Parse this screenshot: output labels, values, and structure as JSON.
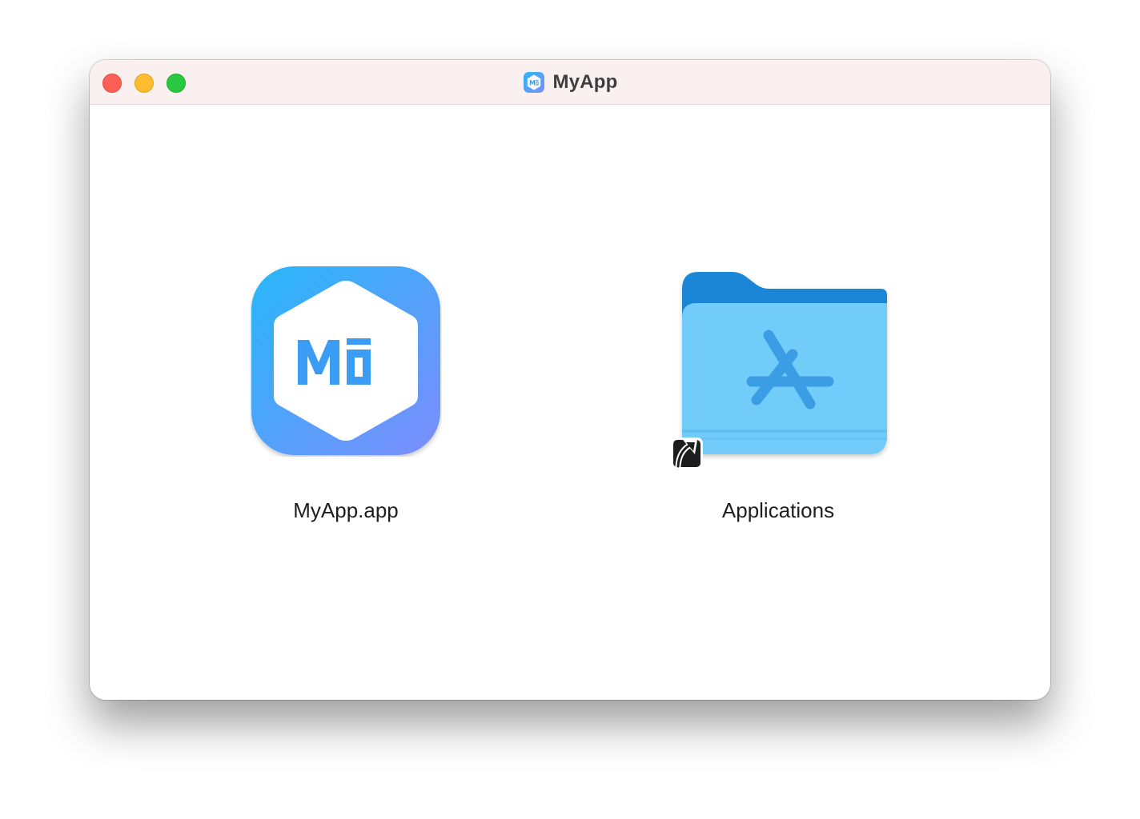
{
  "window": {
    "title": "MyApp",
    "title_icon": "app-logo-icon"
  },
  "controls": {
    "close": "close-button",
    "minimize": "minimize-button",
    "zoom": "zoom-button"
  },
  "items": [
    {
      "label": "MyApp.app",
      "icon": "app-icon",
      "icon_text": "Mō"
    },
    {
      "label": "Applications",
      "icon": "applications-folder-icon",
      "alias": "alias-arrow-icon"
    }
  ],
  "colors": {
    "titlebar": "#faf0f0",
    "close": "#fe5f57",
    "minimize": "#febc2e",
    "zoom": "#28c840",
    "app_gradient_start": "#2bb6f6",
    "app_gradient_end": "#7b8ffd",
    "folder_light": "#74cdfa",
    "folder_dark": "#2f97dc"
  }
}
